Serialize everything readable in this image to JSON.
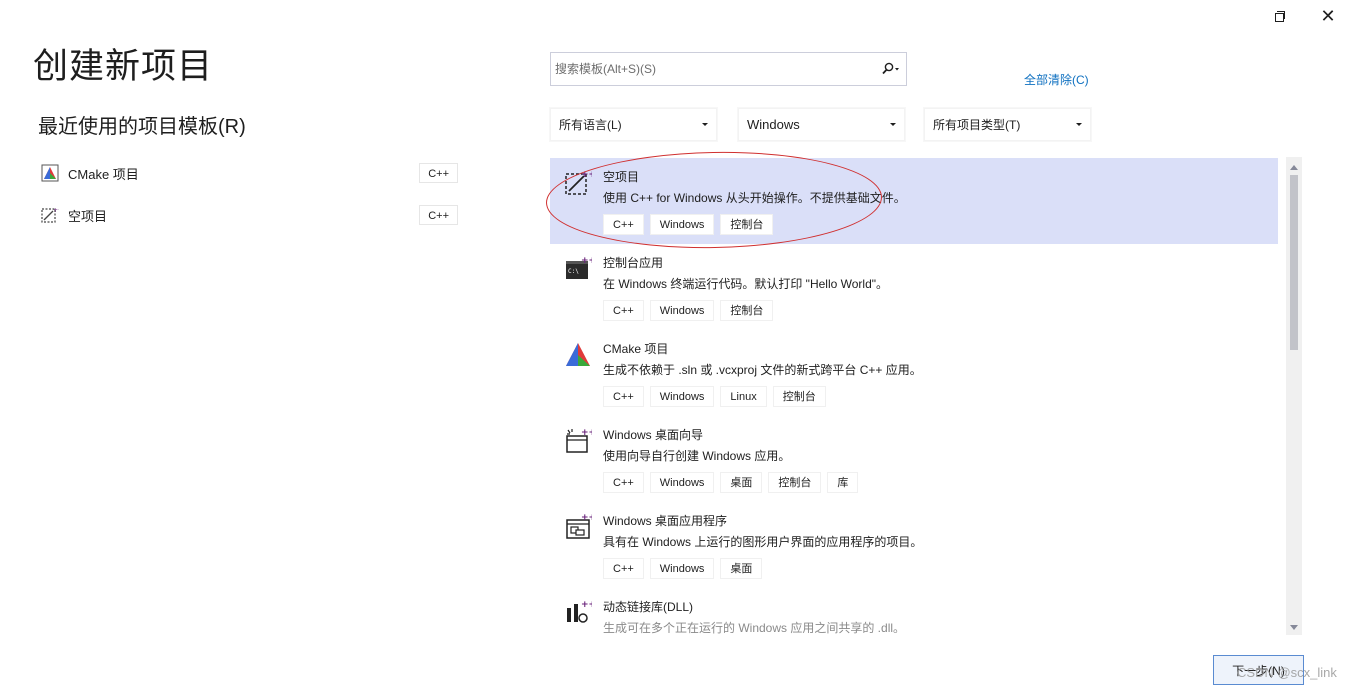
{
  "window": {
    "restore_label": "",
    "close_label": "✕"
  },
  "page_title": "创建新项目",
  "recent": {
    "heading": "最近使用的项目模板(R)",
    "items": [
      {
        "label": "CMake 项目",
        "lang": "C++",
        "icon": "cmake-icon"
      },
      {
        "label": "空项目",
        "lang": "C++",
        "icon": "empty-project-icon"
      }
    ]
  },
  "search": {
    "placeholder": "搜索模板(Alt+S)(S)",
    "value": "",
    "icon": "search-icon"
  },
  "clear_all_label": "全部清除(C)",
  "filters": {
    "language": "所有语言(L)",
    "platform": "Windows",
    "project_type": "所有项目类型(T)"
  },
  "templates": [
    {
      "name": "空项目",
      "desc": "使用 C++ for Windows 从头开始操作。不提供基础文件。",
      "tags": [
        "C++",
        "Windows",
        "控制台"
      ],
      "icon": "empty-project-icon",
      "selected": true
    },
    {
      "name": "控制台应用",
      "desc": "在 Windows 终端运行代码。默认打印 \"Hello World\"。",
      "tags": [
        "C++",
        "Windows",
        "控制台"
      ],
      "icon": "console-app-icon"
    },
    {
      "name": "CMake 项目",
      "desc": "生成不依赖于 .sln 或 .vcxproj 文件的新式跨平台 C++ 应用。",
      "tags": [
        "C++",
        "Windows",
        "Linux",
        "控制台"
      ],
      "icon": "cmake-icon"
    },
    {
      "name": "Windows 桌面向导",
      "desc": "使用向导自行创建 Windows 应用。",
      "tags": [
        "C++",
        "Windows",
        "桌面",
        "控制台",
        "库"
      ],
      "icon": "desktop-wizard-icon"
    },
    {
      "name": "Windows 桌面应用程序",
      "desc": "具有在 Windows 上运行的图形用户界面的应用程序的项目。",
      "tags": [
        "C++",
        "Windows",
        "桌面"
      ],
      "icon": "desktop-app-icon"
    },
    {
      "name": "动态链接库(DLL)",
      "desc": "生成可在多个正在运行的 Windows 应用之间共享的 .dll。",
      "tags": [],
      "icon": "dll-icon"
    }
  ],
  "next_button": "下一步(N)",
  "watermark": "CSDN @scx_link",
  "colors": {
    "selected_row": "#dadff8",
    "link": "#0e70c0",
    "annotation": "#d03030",
    "vs_purple": "#68217a"
  }
}
